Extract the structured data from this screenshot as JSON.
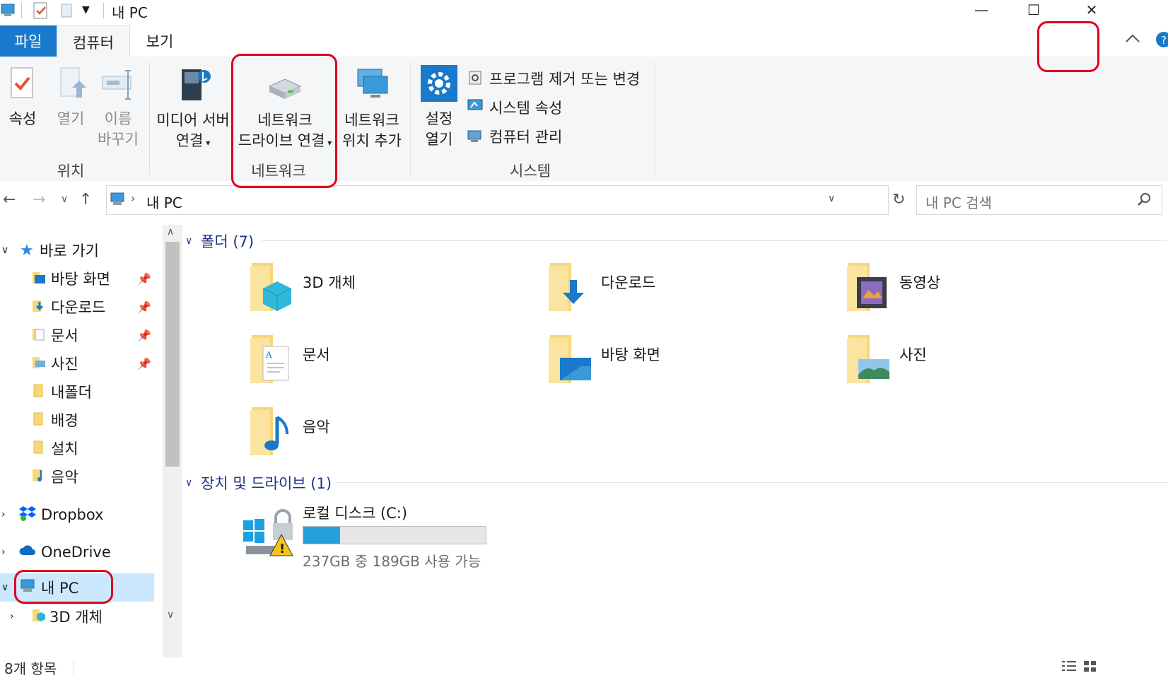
{
  "window": {
    "title": "내 PC"
  },
  "tabs": {
    "file": "파일",
    "computer": "컴퓨터",
    "view": "보기"
  },
  "ribbon": {
    "location": {
      "group_label": "위치",
      "properties": "속성",
      "open": "열기",
      "rename_1": "이름",
      "rename_2": "바꾸기"
    },
    "media": {
      "line1": "미디어 서버",
      "line2": "연결"
    },
    "network": {
      "group_label": "네트워크",
      "map_drive_1": "네트워크",
      "map_drive_2": "드라이브 연결",
      "add_location_1": "네트워크",
      "add_location_2": "위치 추가"
    },
    "system": {
      "group_label": "시스템",
      "open_settings_1": "설정",
      "open_settings_2": "열기",
      "uninstall": "프로그램 제거 또는 변경",
      "sys_props": "시스템 속성",
      "manage": "컴퓨터 관리"
    }
  },
  "address": {
    "crumb": "내 PC",
    "search_placeholder": "내 PC 검색"
  },
  "nav": {
    "quick_access": "바로 가기",
    "items": [
      "바탕 화면",
      "다운로드",
      "문서",
      "사진",
      "내폴더",
      "배경",
      "설치",
      "음악"
    ],
    "dropbox": "Dropbox",
    "onedrive": "OneDrive",
    "this_pc": "내 PC",
    "objects3d": "3D 개체"
  },
  "content": {
    "folders_header": "폴더 (7)",
    "folders": [
      "3D 개체",
      "다운로드",
      "동영상",
      "문서",
      "바탕 화면",
      "사진",
      "음악"
    ],
    "drives_header": "장치 및 드라이브 (1)",
    "drive": {
      "name": "로컬 디스크 (C:)",
      "free_text": "237GB 중 189GB 사용 가능",
      "used_fraction": 0.2
    }
  },
  "status": {
    "items": "8개 항목"
  },
  "colors": {
    "accent": "#1979ca",
    "selection": "#cce8ff",
    "annotation": "#e0001a",
    "folder": "#f8d775"
  }
}
